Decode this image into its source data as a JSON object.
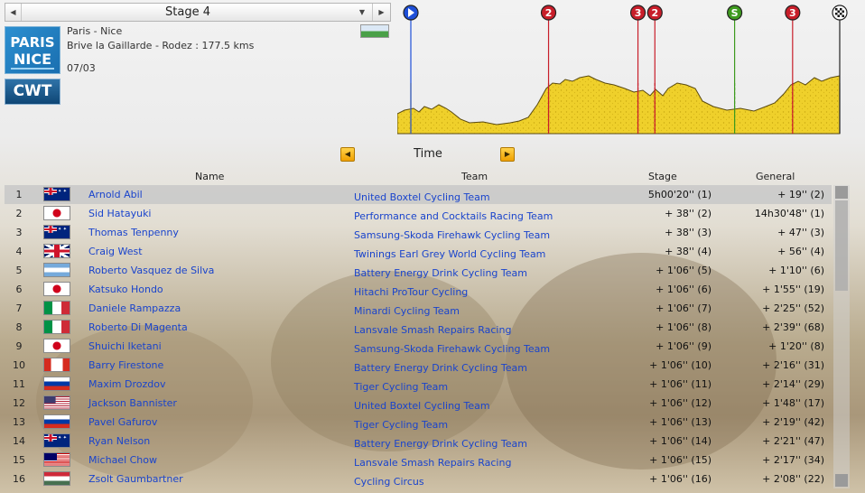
{
  "stage_selector": {
    "label": "Stage 4",
    "prev_icon": "arrow-left-icon",
    "next_icon": "arrow-right-icon",
    "dropdown_icon": "chevron-down-icon"
  },
  "race": {
    "logo_line1": "PARIS",
    "logo_line2": "NICE",
    "badge": "CWT",
    "name": "Paris - Nice",
    "route": "Brive la Gaillarde - Rodez : 177.5 kms",
    "date": "07/03"
  },
  "profile": {
    "markers": [
      {
        "icon": "start-icon",
        "label": "",
        "km": 0,
        "color": "#1e4fd8"
      },
      {
        "icon": "climb-cat-icon",
        "label": "2",
        "km": 57,
        "color": "#c81e2a"
      },
      {
        "icon": "climb-cat-icon",
        "label": "3",
        "km": 94,
        "color": "#c81e2a"
      },
      {
        "icon": "climb-cat-icon",
        "label": "2",
        "km": 101,
        "color": "#c81e2a"
      },
      {
        "icon": "sprint-icon",
        "label": "S",
        "km": 134,
        "color": "#3e9a1e"
      },
      {
        "icon": "climb-cat-icon",
        "label": "3",
        "km": 158,
        "color": "#c81e2a"
      },
      {
        "icon": "finish-icon",
        "label": "",
        "km": 177.5,
        "color": "#222222"
      }
    ]
  },
  "time_control": {
    "label": "Time",
    "prev_icon": "arrow-left-icon",
    "next_icon": "arrow-right-icon"
  },
  "table": {
    "columns": {
      "name": "Name",
      "team": "Team",
      "stage": "Stage",
      "general": "General"
    },
    "rows": [
      {
        "pos": "1",
        "flag": "aus",
        "name": "Arnold Abil",
        "team": "United Boxtel Cycling Team",
        "stage": "5h00'20'' (1)",
        "general": "+ 19'' (2)"
      },
      {
        "pos": "2",
        "flag": "jpn",
        "name": "Sid Hatayuki",
        "team": "Performance and Cocktails Racing Team",
        "stage": "+ 38'' (2)",
        "general": "14h30'48'' (1)"
      },
      {
        "pos": "3",
        "flag": "aus",
        "name": "Thomas Tenpenny",
        "team": "Samsung-Skoda Firehawk Cycling Team",
        "stage": "+ 38'' (3)",
        "general": "+ 47'' (3)"
      },
      {
        "pos": "4",
        "flag": "gbr",
        "name": "Craig West",
        "team": "Twinings Earl Grey World Cycling Team",
        "stage": "+ 38'' (4)",
        "general": "+ 56'' (4)"
      },
      {
        "pos": "5",
        "flag": "arg",
        "name": "Roberto Vasquez de Silva",
        "team": "Battery Energy Drink Cycling Team",
        "stage": "+ 1'06'' (5)",
        "general": "+ 1'10'' (6)"
      },
      {
        "pos": "6",
        "flag": "jpn",
        "name": "Katsuko Hondo",
        "team": "Hitachi ProTour Cycling",
        "stage": "+ 1'06'' (6)",
        "general": "+ 1'55'' (19)"
      },
      {
        "pos": "7",
        "flag": "ita",
        "name": "Daniele Rampazza",
        "team": "Minardi Cycling Team",
        "stage": "+ 1'06'' (7)",
        "general": "+ 2'25'' (52)"
      },
      {
        "pos": "8",
        "flag": "ita",
        "name": "Roberto Di Magenta",
        "team": "Lansvale Smash Repairs Racing",
        "stage": "+ 1'06'' (8)",
        "general": "+ 2'39'' (68)"
      },
      {
        "pos": "9",
        "flag": "jpn",
        "name": "Shuichi Iketani",
        "team": "Samsung-Skoda Firehawk Cycling Team",
        "stage": "+ 1'06'' (9)",
        "general": "+ 1'20'' (8)"
      },
      {
        "pos": "10",
        "flag": "can",
        "name": "Barry Firestone",
        "team": "Battery Energy Drink Cycling Team",
        "stage": "+ 1'06'' (10)",
        "general": "+ 2'16'' (31)"
      },
      {
        "pos": "11",
        "flag": "rus",
        "name": "Maxim Drozdov",
        "team": "Tiger Cycling Team",
        "stage": "+ 1'06'' (11)",
        "general": "+ 2'14'' (29)"
      },
      {
        "pos": "12",
        "flag": "usa",
        "name": "Jackson Bannister",
        "team": "United Boxtel Cycling Team",
        "stage": "+ 1'06'' (12)",
        "general": "+ 1'48'' (17)"
      },
      {
        "pos": "13",
        "flag": "rus",
        "name": "Pavel Gafurov",
        "team": "Tiger Cycling Team",
        "stage": "+ 1'06'' (13)",
        "general": "+ 2'19'' (42)"
      },
      {
        "pos": "14",
        "flag": "aus",
        "name": "Ryan Nelson",
        "team": "Battery Energy Drink Cycling Team",
        "stage": "+ 1'06'' (14)",
        "general": "+ 2'21'' (47)"
      },
      {
        "pos": "15",
        "flag": "mys",
        "name": "Michael Chow",
        "team": "Lansvale Smash Repairs Racing",
        "stage": "+ 1'06'' (15)",
        "general": "+ 2'17'' (34)"
      },
      {
        "pos": "16",
        "flag": "hun",
        "name": "Zsolt Gaumbartner",
        "team": "Cycling Circus",
        "stage": "+ 1'06'' (16)",
        "general": "+ 2'08'' (22)"
      }
    ]
  },
  "colors": {
    "link": "#1a44cc",
    "profile_fill": "#f2d12a",
    "selected_row": "#c8c8c8"
  }
}
